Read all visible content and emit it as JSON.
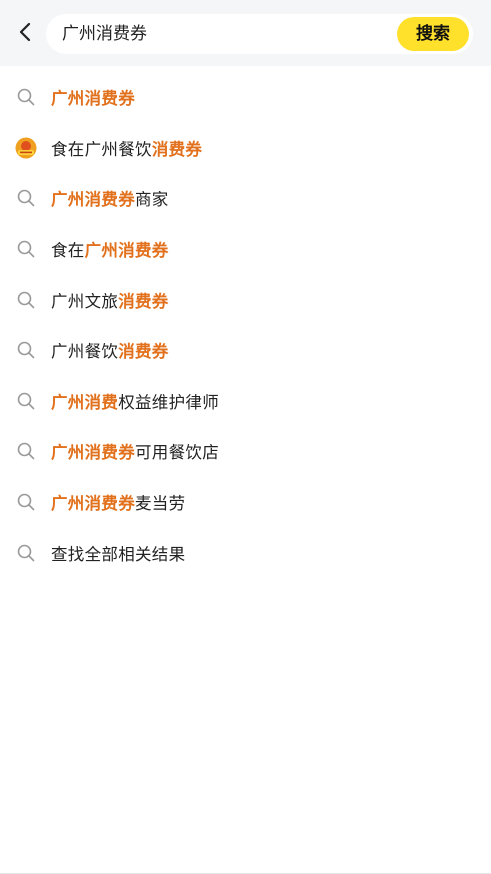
{
  "header": {
    "query": "广州消费券",
    "search_button_label": "搜索"
  },
  "suggestions": [
    {
      "icon": "search-icon",
      "parts": [
        {
          "t": "广州消费券",
          "hl": true
        }
      ]
    },
    {
      "icon": "merchant-logo-icon",
      "parts": [
        {
          "t": "食在广州餐饮",
          "hl": false
        },
        {
          "t": "消费券",
          "hl": true
        }
      ]
    },
    {
      "icon": "search-icon",
      "parts": [
        {
          "t": "广州消费券",
          "hl": true
        },
        {
          "t": "商家",
          "hl": false
        }
      ]
    },
    {
      "icon": "search-icon",
      "parts": [
        {
          "t": "食在",
          "hl": false
        },
        {
          "t": "广州消费券",
          "hl": true
        }
      ]
    },
    {
      "icon": "search-icon",
      "parts": [
        {
          "t": "广州文旅",
          "hl": false
        },
        {
          "t": "消费券",
          "hl": true
        }
      ]
    },
    {
      "icon": "search-icon",
      "parts": [
        {
          "t": "广州餐饮",
          "hl": false
        },
        {
          "t": "消费券",
          "hl": true
        }
      ]
    },
    {
      "icon": "search-icon",
      "parts": [
        {
          "t": "广州消费",
          "hl": true
        },
        {
          "t": "权益维护律师",
          "hl": false
        }
      ]
    },
    {
      "icon": "search-icon",
      "parts": [
        {
          "t": "广州消费券",
          "hl": true
        },
        {
          "t": "可用餐饮店",
          "hl": false
        }
      ]
    },
    {
      "icon": "search-icon",
      "parts": [
        {
          "t": "广州消费券",
          "hl": true
        },
        {
          "t": "麦当劳",
          "hl": false
        }
      ]
    },
    {
      "icon": "search-icon",
      "parts": [
        {
          "t": "查找全部相关结果",
          "hl": false
        }
      ]
    }
  ],
  "colors": {
    "highlight": "#e2711d",
    "search_button": "#ffe02b",
    "header_bg": "#f5f6f8"
  }
}
